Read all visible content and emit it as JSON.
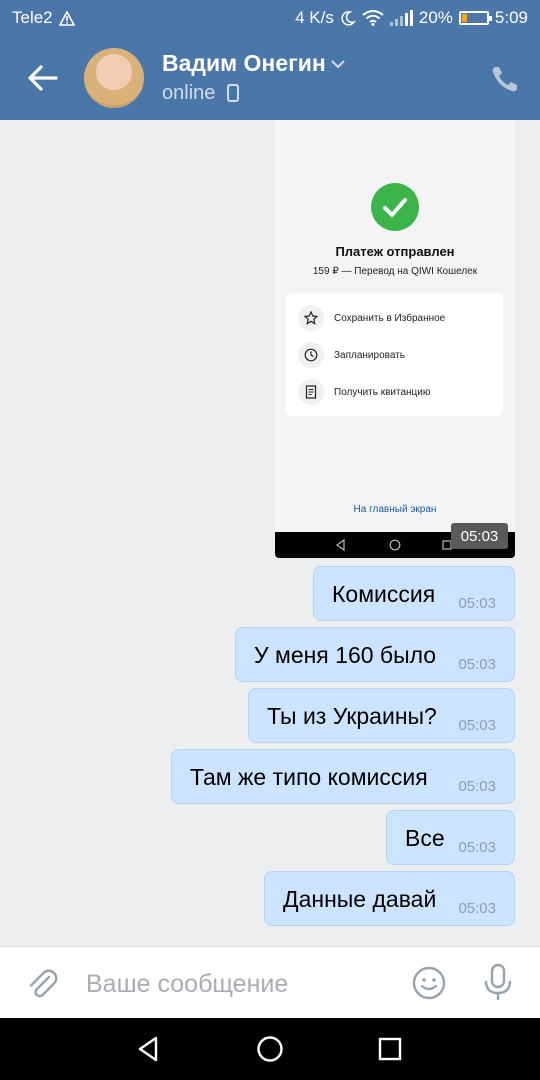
{
  "status_bar": {
    "carrier": "Tele2",
    "speed": "4 K/s",
    "battery": "20%",
    "battery_level": 0.2,
    "time": "5:09"
  },
  "header": {
    "contact_name": "Вадим Онегин",
    "status": "online"
  },
  "screenshot": {
    "title": "Платеж отправлен",
    "subtitle": "159 ₽ — Перевод на QIWI Кошелек",
    "actions": [
      {
        "label": "Сохранить в Избранное",
        "icon": "star-icon"
      },
      {
        "label": "Запланировать",
        "icon": "clock-icon"
      },
      {
        "label": "Получить квитанцию",
        "icon": "receipt-icon"
      }
    ],
    "link": "На главный экран",
    "time": "05:03"
  },
  "messages": [
    {
      "text": "Комиссия",
      "time": "05:03"
    },
    {
      "text": "У меня 160 было",
      "time": "05:03"
    },
    {
      "text": "Ты из Украины?",
      "time": "05:03"
    },
    {
      "text": "Там же типо комиссия",
      "time": "05:03"
    },
    {
      "text": "Все",
      "time": "05:03"
    },
    {
      "text": "Данные давай",
      "time": "05:03"
    }
  ],
  "input": {
    "placeholder": "Ваше сообщение"
  },
  "colors": {
    "header": "#4a76a8",
    "bubble": "#cce4ff",
    "background": "#edeef0",
    "success": "#3bb54a"
  }
}
